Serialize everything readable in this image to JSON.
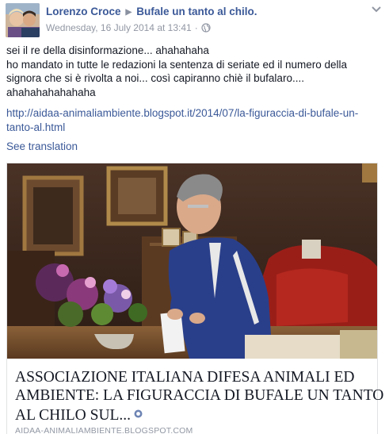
{
  "post": {
    "author": "Lorenzo Croce",
    "group": "Bufale un tanto al chilo.",
    "timestamp": "Wednesday, 16 July 2014 at 13:41",
    "separator": "·",
    "message_lines": [
      "sei il re della disinformazione... ahahahaha",
      "ho mandato in tutte le redazioni la sentenza di seriate ed il numero della",
      "signora che si è rivolta a noi... così capiranno chiè il bufalaro....",
      "ahahahahahahaha"
    ],
    "link_lines": [
      "http://aidaa-animaliambiente.blogspot.it/2014/07/la-figuraccia-di-bufale-un-",
      "tanto-al.html"
    ],
    "see_translation": "See translation"
  },
  "share": {
    "title_lines": [
      "ASSOCIAZIONE ITALIANA DIFESA ANIMALI ED",
      "AMBIENTE: LA FIGURACCIA DI BUFALE UN TANTO",
      "AL CHILO SUL..."
    ],
    "domain": "AIDAA-ANIMALIAMBIENTE.BLOGSPOT.COM"
  },
  "icons": {
    "header_arrow": "right-triangle-icon",
    "audience": "globe-icon",
    "menu": "chevron-down-icon",
    "verify": "shared-link-icon"
  },
  "colors": {
    "link_blue": "#3b5998",
    "meta_grey": "#9197a3",
    "text": "#141823"
  }
}
